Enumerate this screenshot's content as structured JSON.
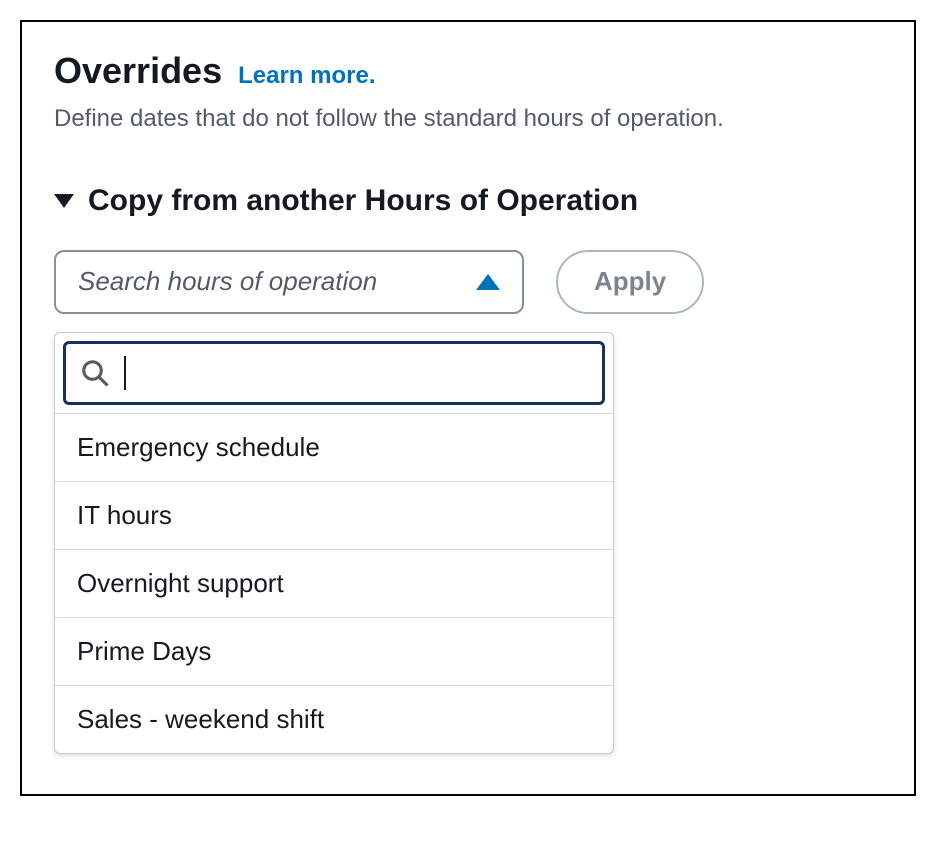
{
  "header": {
    "title": "Overrides",
    "learn_more": "Learn more.",
    "description": "Define dates that do not follow the standard hours of operation."
  },
  "copy_section": {
    "title": "Copy from another Hours of Operation",
    "select_placeholder": "Search hours of operation",
    "apply_label": "Apply",
    "search_value": "",
    "options": [
      "Emergency schedule",
      "IT hours",
      "Overnight support",
      "Prime Days",
      "Sales - weekend shift"
    ]
  }
}
